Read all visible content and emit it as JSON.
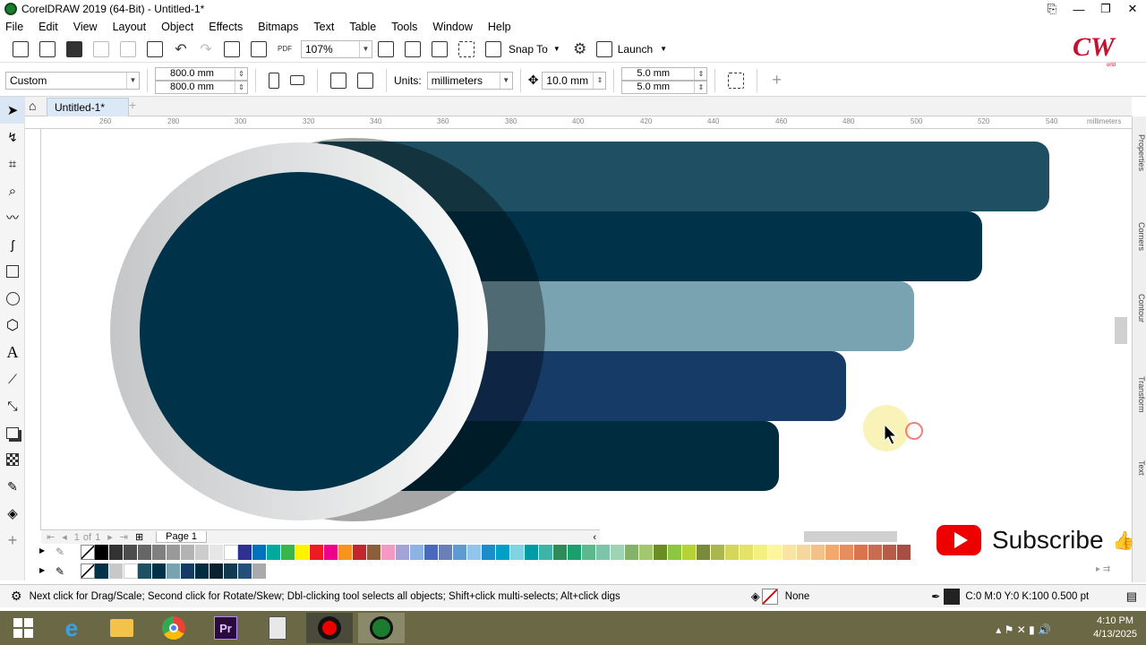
{
  "window": {
    "title": "CorelDRAW 2019 (64-Bit) - Untitled-1*"
  },
  "menu": [
    "File",
    "Edit",
    "View",
    "Layout",
    "Object",
    "Effects",
    "Bitmaps",
    "Text",
    "Table",
    "Tools",
    "Window",
    "Help"
  ],
  "toolbar": {
    "zoom": "107%",
    "snap_label": "Snap To",
    "launch_label": "Launch"
  },
  "property_bar": {
    "preset": "Custom",
    "width": "800.0 mm",
    "height": "800.0 mm",
    "units_label": "Units:",
    "units_value": "millimeters",
    "nudge": "10.0 mm",
    "dup_x": "5.0 mm",
    "dup_y": "5.0 mm"
  },
  "document_tab": "Untitled-1*",
  "ruler": {
    "units": "millimeters",
    "ticks": [
      "260",
      "280",
      "300",
      "320",
      "340",
      "360",
      "380",
      "400",
      "420",
      "440",
      "460",
      "480",
      "500",
      "520",
      "540"
    ]
  },
  "dockers": [
    "Properties",
    "Corners",
    "Contour",
    "Transform",
    "Text"
  ],
  "page_nav": {
    "current": "1",
    "of_label": "of",
    "total": "1",
    "page_tab": "Page 1"
  },
  "status": {
    "hint": "Next click for Drag/Scale; Second click for Rotate/Skew; Dbl-clicking tool selects all objects; Shift+click multi-selects; Alt+click digs",
    "fill": "None",
    "outline": "C:0 M:0 Y:0 K:100  0.500 pt"
  },
  "overlay": {
    "subscribe": "Subscribe",
    "logo": "CW",
    "logo_sub": "orld"
  },
  "taskbar": {
    "time": "4:10 PM",
    "date": "4/13/2025"
  },
  "colors": {
    "bar1": "#1e4f62",
    "bar2": "#003349",
    "bar3": "#7aa3b1",
    "bar4": "#163b67",
    "bar5": "#002c40",
    "circle": "#00334a",
    "ring": "#e5e5e5"
  }
}
